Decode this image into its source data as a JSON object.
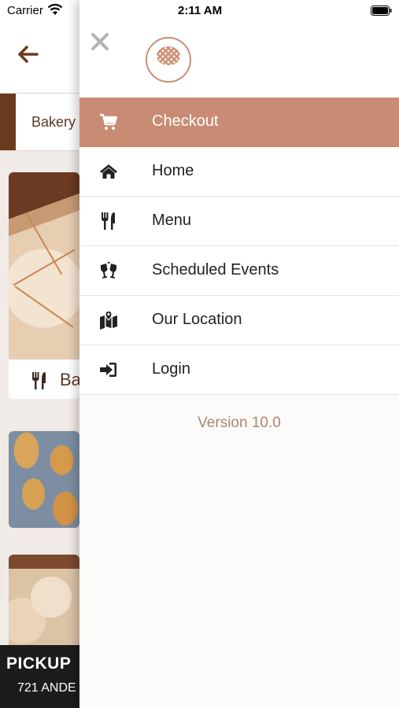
{
  "status_bar": {
    "carrier": "Carrier",
    "time": "2:11 AM"
  },
  "background": {
    "tab_label": "Bakery",
    "card_label": "Ba",
    "pickup_title": "PICKUP",
    "pickup_address": "721 ANDE"
  },
  "drawer": {
    "menu": [
      {
        "label": "Checkout",
        "icon": "cart-icon",
        "active": true
      },
      {
        "label": "Home",
        "icon": "home-icon",
        "active": false
      },
      {
        "label": "Menu",
        "icon": "cutlery-icon",
        "active": false
      },
      {
        "label": "Scheduled Events",
        "icon": "glasses-toast-icon",
        "active": false
      },
      {
        "label": "Our Location",
        "icon": "map-icon",
        "active": false
      },
      {
        "label": "Login",
        "icon": "sign-in-icon",
        "active": false
      }
    ],
    "version": "Version 10.0"
  },
  "colors": {
    "accent": "#c98b73",
    "brown": "#6b3a1f",
    "version_text": "#a8876f"
  }
}
